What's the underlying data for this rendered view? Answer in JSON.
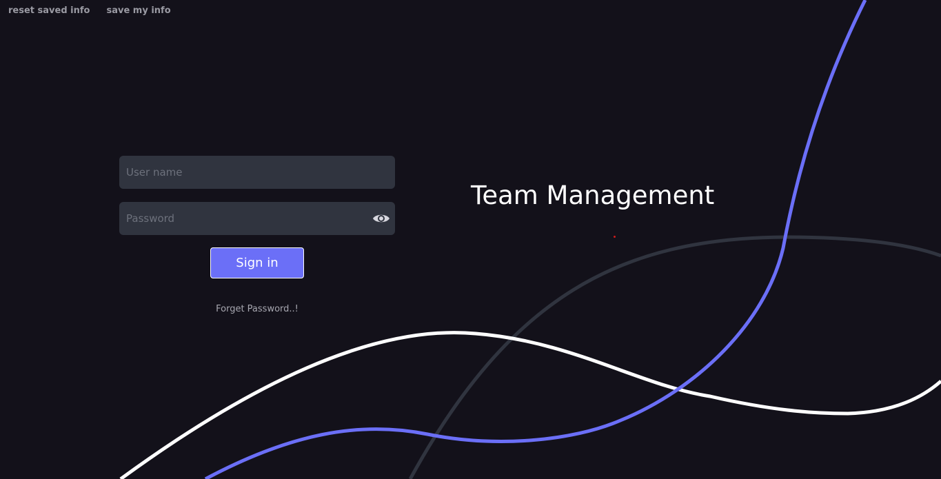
{
  "top_links": {
    "reset_label": "reset saved info",
    "save_label": "save my info"
  },
  "login": {
    "username_placeholder": "User name",
    "password_placeholder": "Password",
    "signin_label": "Sign in",
    "forget_label": "Forget Password..!"
  },
  "title": "Team Management",
  "icons": {
    "password_toggle": "eye-icon"
  },
  "colors": {
    "background": "#13111a",
    "field": "#30343f",
    "accent": "#6b6ff7",
    "curve_white": "#ffffff",
    "curve_blue": "#6b6ff7",
    "curve_gray": "#30343f"
  }
}
